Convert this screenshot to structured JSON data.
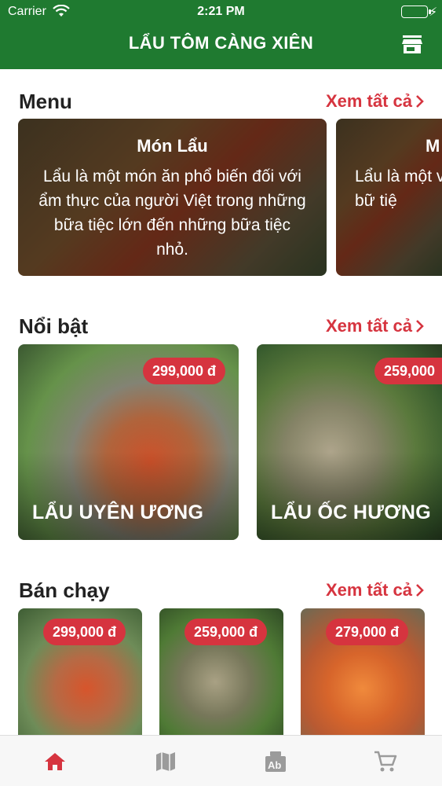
{
  "status_bar": {
    "carrier": "Carrier",
    "time": "2:21 PM"
  },
  "header": {
    "title": "LẨU TÔM CÀNG XIÊN",
    "store_icon": "store-icon"
  },
  "colors": {
    "header_bg": "#1f7a30",
    "accent": "#d6343f",
    "tab_active": "#d6343f",
    "tab_inactive": "#9b9b9b"
  },
  "sections": {
    "menu": {
      "title": "Menu",
      "see_all": "Xem tất cả",
      "cards": [
        {
          "title": "Món Lẩu",
          "description": "Lẩu là một món ăn phổ biến đối với ẩm thực của người Việt trong những bữa tiệc lớn đến những bữa tiệc nhỏ."
        },
        {
          "title": "M",
          "description": "Lẩu là một với ẩm thự những bữ tiệ"
        }
      ]
    },
    "featured": {
      "title": "Nổi bật",
      "see_all": "Xem tất cả",
      "items": [
        {
          "name": "LẨU UYÊN ƯƠNG",
          "price": "299,000 đ"
        },
        {
          "name": "LẨU ỐC HƯƠNG",
          "price": "259,000"
        }
      ]
    },
    "best_selling": {
      "title": "Bán chạy",
      "see_all": "Xem tất cả",
      "items": [
        {
          "price": "299,000 đ"
        },
        {
          "price": "259,000 đ"
        },
        {
          "price": "279,000 đ"
        }
      ]
    }
  },
  "tabs": [
    {
      "icon": "home-icon",
      "active": true
    },
    {
      "icon": "map-icon",
      "active": false
    },
    {
      "icon": "menu-book-icon",
      "active": false
    },
    {
      "icon": "cart-icon",
      "active": false
    }
  ]
}
